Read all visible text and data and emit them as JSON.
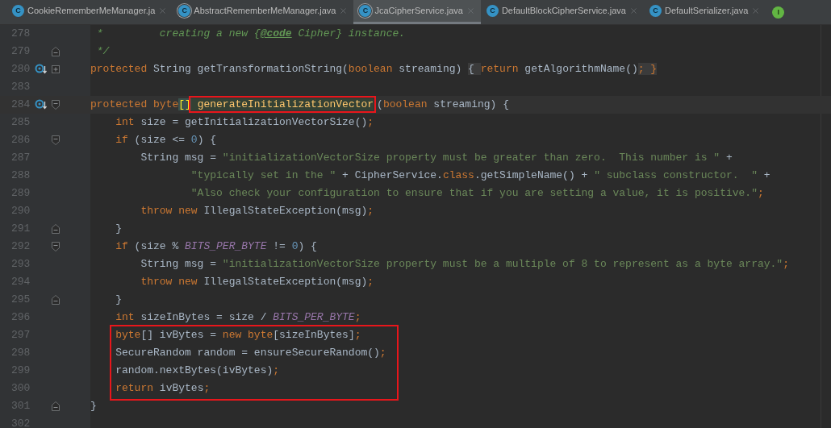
{
  "tabs": [
    {
      "icon": "C",
      "kind": "class",
      "label": "CookieRememberMeManager.ja",
      "selected": false
    },
    {
      "icon": "C",
      "kind": "abstract_class",
      "label": "AbstractRememberMeManager.java",
      "selected": false
    },
    {
      "icon": "C",
      "kind": "abstract_class",
      "label": "JcaCipherService.java",
      "selected": true
    },
    {
      "icon": "C",
      "kind": "class",
      "label": "DefaultBlockCipherService.java",
      "selected": false
    },
    {
      "icon": "C",
      "kind": "class",
      "label": "DefaultSerializer.java",
      "selected": false
    },
    {
      "icon": "I",
      "kind": "interface"
    }
  ],
  "lines": [
    {
      "number": "278",
      "kind": "code",
      "tokens": [
        {
          "kind": "comment",
          "text": " *         creating a new {"
        },
        {
          "kind": "doc_tag",
          "text": "@code"
        },
        {
          "kind": "comment",
          "text": " Cipher} instance."
        }
      ]
    },
    {
      "number": "279",
      "kind": "fold_end",
      "tokens": [
        {
          "kind": "comment",
          "text": " */"
        }
      ]
    },
    {
      "number": "280",
      "kind": "folded",
      "overrides": true,
      "tokens": [
        {
          "kind": "keyword",
          "text": "protected "
        },
        {
          "kind": "plain",
          "text": "String getTransformationString("
        },
        {
          "kind": "keyword",
          "text": "boolean "
        },
        {
          "kind": "plain",
          "text": "streaming) "
        },
        {
          "kind": "fold_brace",
          "text": "{ "
        },
        {
          "kind": "keyword",
          "text": "return "
        },
        {
          "kind": "plain",
          "text": "getAlgorithmName()"
        },
        {
          "kind": "fold_brace_punct",
          "text": "; }"
        }
      ]
    },
    {
      "number": "283",
      "kind": "code"
    },
    {
      "number": "284",
      "kind": "fold_start",
      "overrides": true,
      "current": true,
      "tokens": [
        {
          "kind": "keyword",
          "text": "protected "
        },
        {
          "kind": "keyword",
          "text": "byte"
        },
        {
          "kind": "brace_match",
          "text": "[]"
        },
        {
          "kind": "usage",
          "boxed": true,
          "text": " generateInitializationVector"
        },
        {
          "kind": "plain",
          "text": "("
        },
        {
          "kind": "keyword",
          "text": "boolean "
        },
        {
          "kind": "plain",
          "text": "streaming) {"
        }
      ]
    },
    {
      "number": "285",
      "kind": "code",
      "tokens": [
        {
          "kind": "keyword",
          "text": "    int "
        },
        {
          "kind": "plain",
          "text": "size = getInitializationVectorSize()"
        },
        {
          "kind": "keyword",
          "text": ";"
        }
      ]
    },
    {
      "number": "286",
      "kind": "fold_start",
      "tokens": [
        {
          "kind": "keyword",
          "text": "    if "
        },
        {
          "kind": "plain",
          "text": "(size <= "
        },
        {
          "kind": "number",
          "text": "0"
        },
        {
          "kind": "plain",
          "text": ") {"
        }
      ]
    },
    {
      "number": "287",
      "kind": "code",
      "tokens": [
        {
          "kind": "plain",
          "text": "        String msg = "
        },
        {
          "kind": "string",
          "text": "\"initializationVectorSize property must be greater than zero.  This number is \""
        },
        {
          "kind": "plain",
          "text": " +"
        }
      ]
    },
    {
      "number": "288",
      "kind": "code",
      "tokens": [
        {
          "kind": "string",
          "text": "                \"typically set in the \""
        },
        {
          "kind": "plain",
          "text": " + CipherService."
        },
        {
          "kind": "keyword",
          "text": "class"
        },
        {
          "kind": "plain",
          "text": ".getSimpleName() + "
        },
        {
          "kind": "string",
          "text": "\" subclass constructor.  \""
        },
        {
          "kind": "plain",
          "text": " +"
        }
      ]
    },
    {
      "number": "289",
      "kind": "code",
      "tokens": [
        {
          "kind": "string",
          "text": "                \"Also check your configuration to ensure that if you are setting a value, it is positive.\""
        },
        {
          "kind": "keyword",
          "text": ";"
        }
      ]
    },
    {
      "number": "290",
      "kind": "code",
      "tokens": [
        {
          "kind": "keyword",
          "text": "        throw new "
        },
        {
          "kind": "plain",
          "text": "IllegalStateException(msg)"
        },
        {
          "kind": "keyword",
          "text": ";"
        }
      ]
    },
    {
      "number": "291",
      "kind": "fold_end",
      "tokens": [
        {
          "kind": "plain",
          "text": "    }"
        }
      ]
    },
    {
      "number": "292",
      "kind": "fold_start",
      "tokens": [
        {
          "kind": "keyword",
          "text": "    if "
        },
        {
          "kind": "plain",
          "text": "(size % "
        },
        {
          "kind": "constant",
          "text": "BITS_PER_BYTE"
        },
        {
          "kind": "plain",
          "text": " != "
        },
        {
          "kind": "number",
          "text": "0"
        },
        {
          "kind": "plain",
          "text": ") {"
        }
      ]
    },
    {
      "number": "293",
      "kind": "code",
      "tokens": [
        {
          "kind": "plain",
          "text": "        String msg = "
        },
        {
          "kind": "string",
          "text": "\"initializationVectorSize property must be a multiple of 8 to represent as a byte array.\""
        },
        {
          "kind": "keyword",
          "text": ";"
        }
      ]
    },
    {
      "number": "294",
      "kind": "code",
      "tokens": [
        {
          "kind": "keyword",
          "text": "        throw new "
        },
        {
          "kind": "plain",
          "text": "IllegalStateException(msg)"
        },
        {
          "kind": "keyword",
          "text": ";"
        }
      ]
    },
    {
      "number": "295",
      "kind": "fold_end",
      "tokens": [
        {
          "kind": "plain",
          "text": "    }"
        }
      ]
    },
    {
      "number": "296",
      "kind": "code",
      "tokens": [
        {
          "kind": "keyword",
          "text": "    int "
        },
        {
          "kind": "plain",
          "text": "sizeInBytes = size / "
        },
        {
          "kind": "constant",
          "text": "BITS_PER_BYTE"
        },
        {
          "kind": "keyword",
          "text": ";"
        }
      ]
    },
    {
      "number": "297",
      "kind": "code",
      "in_box": true,
      "tokens": [
        {
          "kind": "keyword",
          "text": "    byte"
        },
        {
          "kind": "plain",
          "text": "[] ivBytes = "
        },
        {
          "kind": "keyword",
          "text": "new byte"
        },
        {
          "kind": "plain",
          "text": "[sizeInBytes]"
        },
        {
          "kind": "keyword",
          "text": ";"
        }
      ]
    },
    {
      "number": "298",
      "kind": "code",
      "in_box": true,
      "tokens": [
        {
          "kind": "plain",
          "text": "    SecureRandom random = ensureSecureRandom()"
        },
        {
          "kind": "keyword",
          "text": ";"
        }
      ]
    },
    {
      "number": "299",
      "kind": "code",
      "in_box": true,
      "tokens": [
        {
          "kind": "plain",
          "text": "    random.nextBytes(ivBytes)"
        },
        {
          "kind": "keyword",
          "text": ";"
        }
      ]
    },
    {
      "number": "300",
      "kind": "code",
      "in_box": true,
      "tokens": [
        {
          "kind": "keyword",
          "text": "    return "
        },
        {
          "kind": "plain",
          "text": "ivBytes"
        },
        {
          "kind": "keyword",
          "text": ";"
        }
      ]
    },
    {
      "number": "301",
      "kind": "fold_end",
      "tokens": [
        {
          "kind": "plain",
          "text": "}"
        }
      ]
    },
    {
      "number": "302",
      "kind": "code"
    }
  ]
}
